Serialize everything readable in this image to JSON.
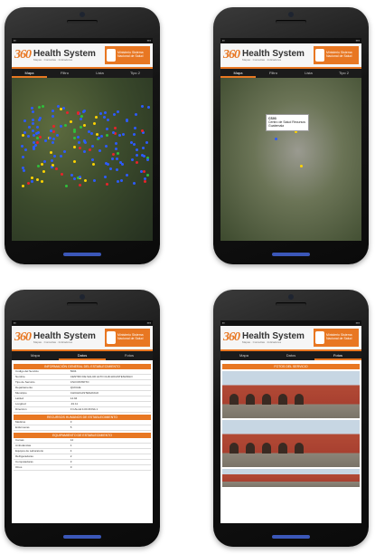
{
  "app": {
    "logo_number": "360",
    "logo_name": "Health System",
    "logo_tagline": "Mapas · Consultas · Indicadores",
    "ministry_label": "Ministerio Sistema Nacional de Salud"
  },
  "phones": [
    {
      "tabs": [
        "Mapa",
        "Filtro",
        "Lista",
        "Tipo 2"
      ],
      "active_tab": 0
    },
    {
      "tabs": [
        "Mapa",
        "Filtro",
        "Lista",
        "Tipo 2"
      ],
      "active_tab": 0,
      "popup": {
        "title": "CS03",
        "lines": [
          "Centro de Salud Recursos",
          "Guatemala"
        ]
      }
    },
    {
      "tabs": [
        "Mapa",
        "Datos",
        "Fotos"
      ],
      "active_tab": 1,
      "section_headers": [
        "INFORMACIÓN GENERAL DEL ESTABLECIMIENTO",
        "RECURSOS HUMANOS DE ESTABLECIMIENTO",
        "EQUIPAMIENTO DE ESTABLECIMIENTO"
      ],
      "rows_a": [
        {
          "k": "Código del Servicio",
          "v": "5004"
        },
        {
          "k": "Nombre",
          "v": "CENTRO DE SALUD ALTO CHICHICASTENANGO"
        },
        {
          "k": "Tipo de Servicio",
          "v": "CS3 DISTRITO"
        },
        {
          "k": "Departamento",
          "v": "QUICHE"
        },
        {
          "k": "Municipio",
          "v": "CHICHICASTENANGO"
        },
        {
          "k": "Latitud",
          "v": "14.94"
        },
        {
          "k": "Longitud",
          "v": "-91.11"
        },
        {
          "k": "Dirección",
          "v": "0 CALLE 0-00 ZONA 1"
        }
      ],
      "rows_b": [
        {
          "k": "Médicos",
          "v": "3"
        },
        {
          "k": "Enfermeras",
          "v": "5"
        }
      ],
      "rows_c": [
        {
          "k": "Camas",
          "v": "12"
        },
        {
          "k": "Ambulancias",
          "v": "1"
        },
        {
          "k": "Equipos de Laboratorio",
          "v": "4"
        },
        {
          "k": "Refrigeradoras",
          "v": "2"
        },
        {
          "k": "Computadoras",
          "v": "3"
        },
        {
          "k": "Otros",
          "v": "0"
        }
      ]
    },
    {
      "tabs": [
        "Mapa",
        "Datos",
        "Fotos"
      ],
      "active_tab": 2,
      "photos_header": "FOTOS DEL SERVICIO"
    }
  ]
}
